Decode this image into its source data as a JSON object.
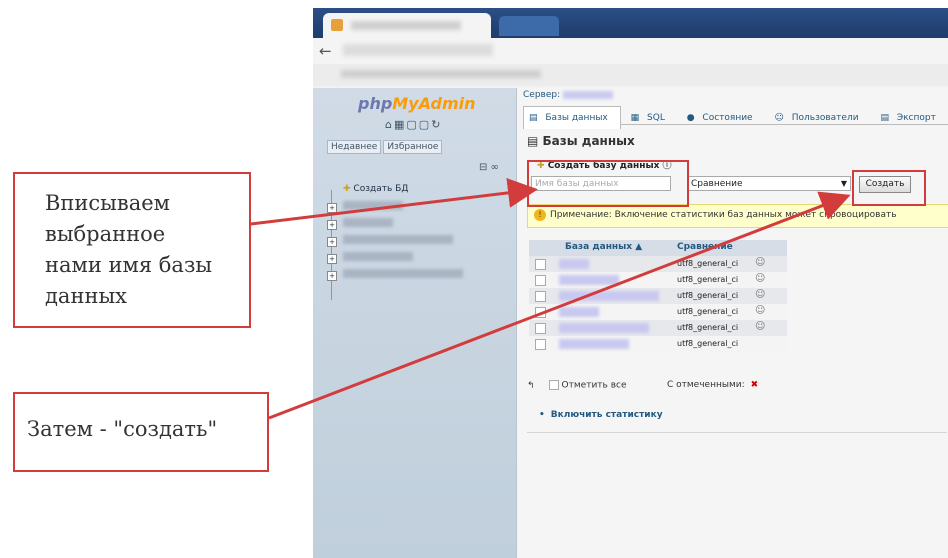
{
  "pma": {
    "logo": {
      "php": "php",
      "myadmin": "MyAdmin"
    },
    "left_tabs": [
      "Недавнее",
      "Избранное"
    ],
    "tree": {
      "create_db": "Создать БД"
    },
    "server_label": "Сервер:",
    "tabs": [
      "Базы данных",
      "SQL",
      "Состояние",
      "Пользователи",
      "Экспорт"
    ],
    "title": "Базы данных",
    "create": {
      "label": "Создать базу данных",
      "name_placeholder": "Имя базы данных",
      "collation_value": "Сравнение",
      "button": "Создать"
    },
    "notice": "Примечание: Включение статистики баз данных может спровоцировать",
    "table": {
      "col_db": "База данных ▲",
      "col_collation": "Сравнение",
      "rows": [
        {
          "collation": "utf8_general_ci"
        },
        {
          "collation": "utf8_general_ci"
        },
        {
          "collation": "utf8_general_ci"
        },
        {
          "collation": "utf8_general_ci"
        },
        {
          "collation": "utf8_general_ci"
        },
        {
          "collation": "utf8_general_ci"
        }
      ]
    },
    "check_all": "Отметить все",
    "with_selected": "С отмеченными:",
    "enable_stats": "Включить статистику"
  },
  "annotations": {
    "callout1": [
      "Вписываем",
      "выбранное",
      "нами имя базы",
      "данных"
    ],
    "callout2": "Затем - \"создать\""
  },
  "colors": {
    "annotation": "#d23c3c",
    "pma_link": "#235a81"
  }
}
